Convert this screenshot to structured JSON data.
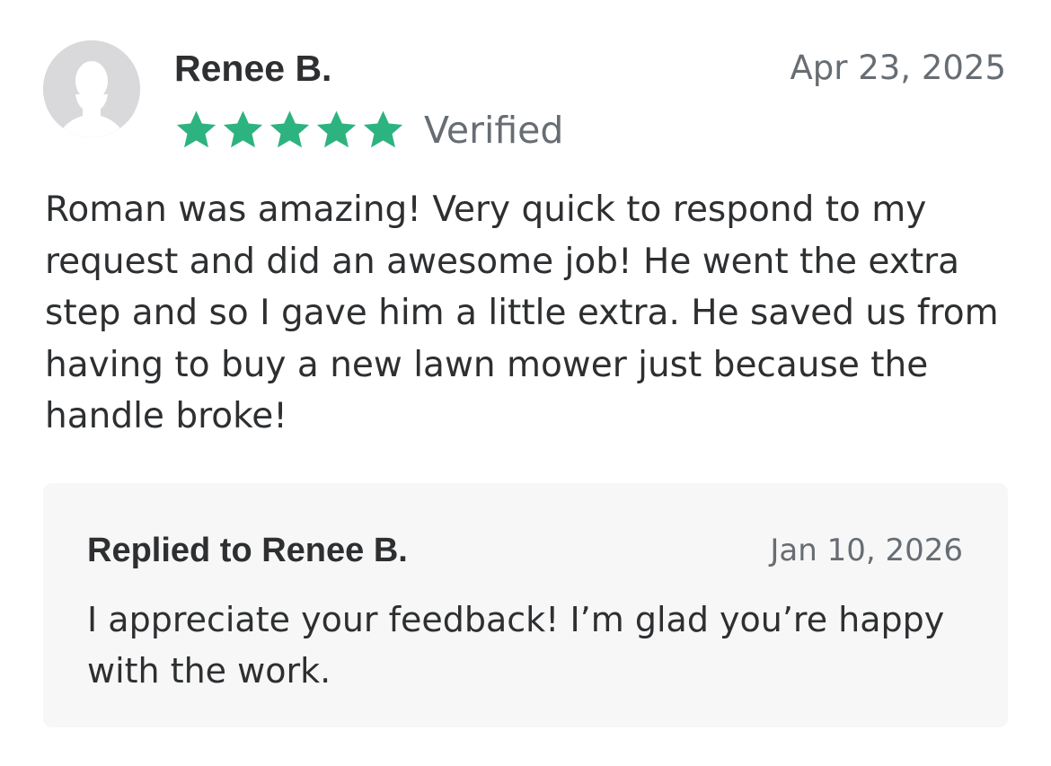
{
  "review": {
    "avatar_icon": "default-user-avatar-icon",
    "reviewer_name": "Renee B.",
    "date": "Apr 23, 2025",
    "rating": 5,
    "rating_max": 5,
    "star_icon": "star-icon",
    "star_color": "#2db37f",
    "verified_label": "Verified",
    "body": "Roman was amazing! Very quick to respond to my request and did an awesome job! He went the extra step and so I gave him a little extra. He saved us from having to buy a new lawn mower just because the handle broke!"
  },
  "reply": {
    "title": "Replied to Renee B.",
    "date": "Jan 10, 2026",
    "body": "I appreciate your feedback! I’m glad you’re happy with the work.",
    "background": "#f7f7f7"
  },
  "colors": {
    "text_primary": "#2d2f31",
    "text_secondary": "#676d73",
    "avatar_bg": "#d9d9db"
  }
}
